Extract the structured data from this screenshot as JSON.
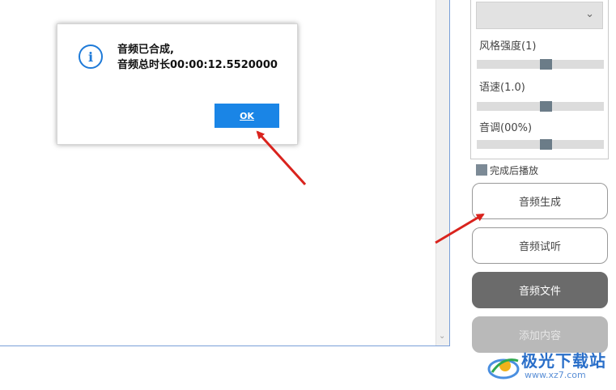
{
  "dialog": {
    "message_line1": "音频已合成,",
    "message_line2": "音频总时长00:00:12.5520000",
    "ok_label": "OK",
    "icon": "info-icon"
  },
  "params": {
    "style_label": "风格强度(1)",
    "speed_label": "语速(1.0)",
    "pitch_label": "音调(00%)",
    "style_level": 0.55,
    "speed_level": 0.55,
    "pitch_level": 0.55
  },
  "play_after_label": "完成后播放",
  "buttons": {
    "generate": "音频生成",
    "preview": "音频试听",
    "file": "音频文件",
    "add": "添加内容"
  },
  "watermark": {
    "title": "极光下载站",
    "url": "www.xz7.com"
  },
  "colors": {
    "accent": "#1a85e6",
    "arrow": "#d9231d",
    "dark_button": "#6b6b6b"
  }
}
